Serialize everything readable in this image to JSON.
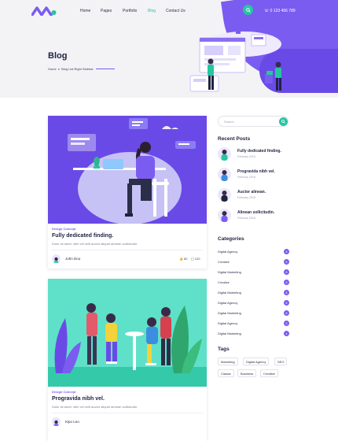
{
  "header": {
    "nav": [
      {
        "label": "Home",
        "active": false
      },
      {
        "label": "Pages",
        "active": false
      },
      {
        "label": "Portfolio",
        "active": false
      },
      {
        "label": "Blog",
        "active": true
      },
      {
        "label": "Contact Us",
        "active": false
      }
    ],
    "phone": "0 123 456 789",
    "icons": {
      "search": "search-icon",
      "phone": "phone-icon"
    },
    "colors": {
      "accent": "#26c6a0",
      "brand": "#7b5cf0",
      "title": "#1f2240"
    }
  },
  "hero": {
    "title": "Blog",
    "breadcrumb": [
      "Home",
      "Blog List Right Sidebar"
    ]
  },
  "posts": [
    {
      "category": "Design Concept",
      "title": "Fully dedicated finding.",
      "excerpt": "Dolor sit amet, nibh vel velit auctor aliquet aenean sollicitudin.",
      "author": "John Doo",
      "likes": "80",
      "comments": "120"
    },
    {
      "category": "Design Concept",
      "title": "Progravida nibh vel.",
      "excerpt": "Dolor sit amet, nibh vel velit auctor aliquet aenean sollicitudin.",
      "author": "Kipo Leo"
    }
  ],
  "sidebar": {
    "search_placeholder": "Search",
    "recent_heading": "Recent Posts",
    "recent": [
      {
        "title": "Fully dedicated finding.",
        "date": "February 2018"
      },
      {
        "title": "Progravida nibh vel.",
        "date": "February 2018"
      },
      {
        "title": "Auctor alinean.",
        "date": "February 2018"
      },
      {
        "title": "Alinean sollicitudin.",
        "date": "February 2018"
      }
    ],
    "categories_heading": "Categories",
    "categories": [
      {
        "name": "Digital Agency",
        "count": "8"
      },
      {
        "name": "Creative",
        "count": "6"
      },
      {
        "name": "Digital Marketing",
        "count": "8"
      },
      {
        "name": "Creative",
        "count": "6"
      },
      {
        "name": "Digital Marketing",
        "count": "8"
      },
      {
        "name": "Digital Agency",
        "count": "6"
      },
      {
        "name": "Digital Marketing",
        "count": "8"
      },
      {
        "name": "Digital Agency",
        "count": "3"
      },
      {
        "name": "Digital Marketing",
        "count": "4"
      }
    ],
    "tags_heading": "Tags",
    "tags": [
      "Marketing",
      "Digital Agency",
      "SEO",
      "Classic",
      "Business",
      "Creative"
    ]
  }
}
